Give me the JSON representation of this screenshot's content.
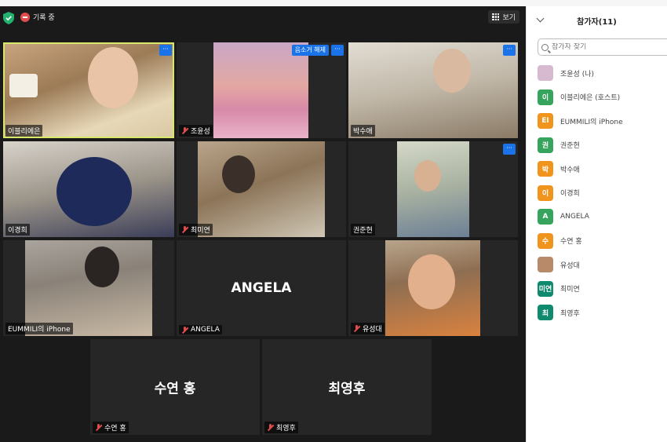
{
  "window": {
    "recording_label": "기록 중",
    "view_label": "보기"
  },
  "tiles": {
    "t1": {
      "name": "이블리에은",
      "more": "···"
    },
    "t2": {
      "name": "조윤성",
      "unmute": "음소거 해제",
      "more": "···"
    },
    "t3": {
      "name": "박수애",
      "more": "···"
    },
    "t4": {
      "name": "이경희"
    },
    "t5": {
      "name": "최미연"
    },
    "t6": {
      "name": "권준현",
      "more": "···"
    },
    "t7": {
      "name": "EUMMILI의 iPhone"
    },
    "t8": {
      "name": "ANGELA",
      "display": "ANGELA"
    },
    "t9": {
      "name": "유성대"
    },
    "t10": {
      "name": "수연 홍",
      "display": "수연 홍"
    },
    "t11": {
      "name": "최영후",
      "display": "최영후"
    }
  },
  "sidebar": {
    "title": "참가자(11)",
    "search_placeholder": "참가자 찾기",
    "participants": [
      {
        "name": "조윤성 (나)",
        "initial": "",
        "color": "#d7b9d0"
      },
      {
        "name": "이블리에은 (호스트)",
        "initial": "이",
        "color": "#36a45c"
      },
      {
        "name": "EUMMILI의 iPhone",
        "initial": "EI",
        "color": "#f0941e"
      },
      {
        "name": "권준현",
        "initial": "권",
        "color": "#36a45c"
      },
      {
        "name": "박수애",
        "initial": "박",
        "color": "#f0941e"
      },
      {
        "name": "이경희",
        "initial": "이",
        "color": "#f0941e"
      },
      {
        "name": "ANGELA",
        "initial": "A",
        "color": "#36a45c"
      },
      {
        "name": "수연 홍",
        "initial": "수",
        "color": "#f0941e"
      },
      {
        "name": "유성대",
        "initial": "",
        "color": "#b98a6a"
      },
      {
        "name": "최미연",
        "initial": "미연",
        "color": "#0f8a6e"
      },
      {
        "name": "최영후",
        "initial": "최",
        "color": "#0f8a6e"
      }
    ]
  }
}
